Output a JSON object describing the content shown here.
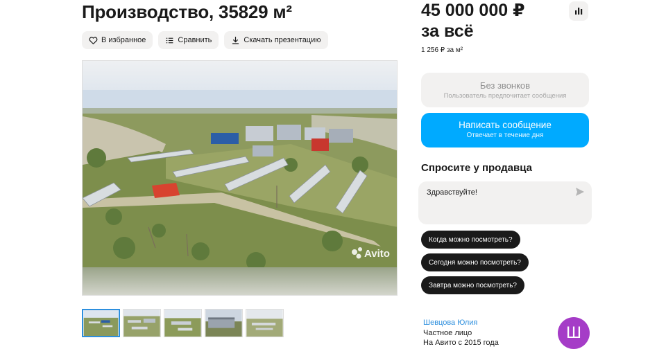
{
  "listing": {
    "title": "Производство, 35829 м²",
    "actions": {
      "favorite": "В избранное",
      "compare": "Сравнить",
      "download": "Скачать презентацию"
    },
    "photo": {
      "watermark": "Avito",
      "thumbnail_count": 5,
      "active_thumbnail": 1
    }
  },
  "price": {
    "amount": "45 000 000 ₽",
    "suffix": "за всё",
    "per_unit": "1 256 ₽ за м²"
  },
  "contact": {
    "no_calls_title": "Без звонков",
    "no_calls_subtitle": "Пользователь предпочитает сообщения",
    "write_title": "Написать сообщение",
    "write_subtitle": "Отвечает в течение дня"
  },
  "ask": {
    "title": "Спросите у продавца",
    "message_value": "Здравствуйте!",
    "quick_questions": [
      "Когда можно посмотреть?",
      "Сегодня можно посмотреть?",
      "Завтра можно посмотреть?"
    ]
  },
  "seller": {
    "name": "Шевцова Юлия",
    "type": "Частное лицо",
    "since": "На Авито с 2015 года",
    "avatar_letter": "Ш"
  },
  "colors": {
    "accent": "#00aaff",
    "link": "#2d8fde",
    "avatar": "#a53cc7"
  }
}
